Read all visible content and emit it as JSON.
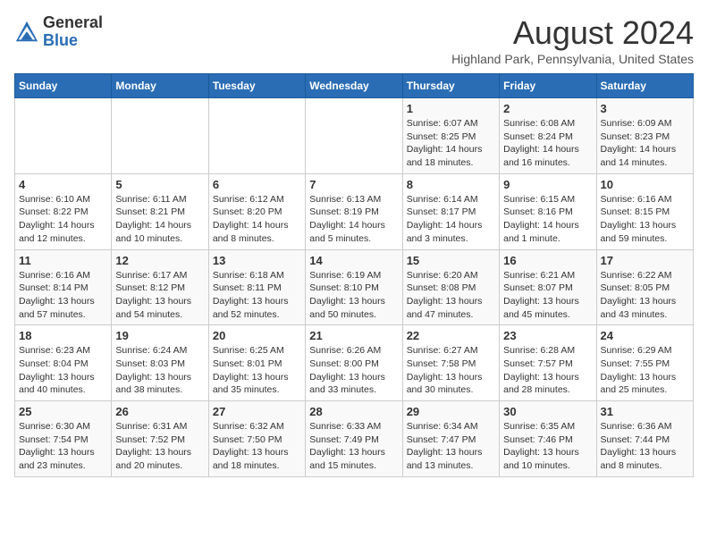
{
  "header": {
    "logo_general": "General",
    "logo_blue": "Blue",
    "month_year": "August 2024",
    "location": "Highland Park, Pennsylvania, United States"
  },
  "weekdays": [
    "Sunday",
    "Monday",
    "Tuesday",
    "Wednesday",
    "Thursday",
    "Friday",
    "Saturday"
  ],
  "weeks": [
    [
      {
        "day": "",
        "info": ""
      },
      {
        "day": "",
        "info": ""
      },
      {
        "day": "",
        "info": ""
      },
      {
        "day": "",
        "info": ""
      },
      {
        "day": "1",
        "info": "Sunrise: 6:07 AM\nSunset: 8:25 PM\nDaylight: 14 hours\nand 18 minutes."
      },
      {
        "day": "2",
        "info": "Sunrise: 6:08 AM\nSunset: 8:24 PM\nDaylight: 14 hours\nand 16 minutes."
      },
      {
        "day": "3",
        "info": "Sunrise: 6:09 AM\nSunset: 8:23 PM\nDaylight: 14 hours\nand 14 minutes."
      }
    ],
    [
      {
        "day": "4",
        "info": "Sunrise: 6:10 AM\nSunset: 8:22 PM\nDaylight: 14 hours\nand 12 minutes."
      },
      {
        "day": "5",
        "info": "Sunrise: 6:11 AM\nSunset: 8:21 PM\nDaylight: 14 hours\nand 10 minutes."
      },
      {
        "day": "6",
        "info": "Sunrise: 6:12 AM\nSunset: 8:20 PM\nDaylight: 14 hours\nand 8 minutes."
      },
      {
        "day": "7",
        "info": "Sunrise: 6:13 AM\nSunset: 8:19 PM\nDaylight: 14 hours\nand 5 minutes."
      },
      {
        "day": "8",
        "info": "Sunrise: 6:14 AM\nSunset: 8:17 PM\nDaylight: 14 hours\nand 3 minutes."
      },
      {
        "day": "9",
        "info": "Sunrise: 6:15 AM\nSunset: 8:16 PM\nDaylight: 14 hours\nand 1 minute."
      },
      {
        "day": "10",
        "info": "Sunrise: 6:16 AM\nSunset: 8:15 PM\nDaylight: 13 hours\nand 59 minutes."
      }
    ],
    [
      {
        "day": "11",
        "info": "Sunrise: 6:16 AM\nSunset: 8:14 PM\nDaylight: 13 hours\nand 57 minutes."
      },
      {
        "day": "12",
        "info": "Sunrise: 6:17 AM\nSunset: 8:12 PM\nDaylight: 13 hours\nand 54 minutes."
      },
      {
        "day": "13",
        "info": "Sunrise: 6:18 AM\nSunset: 8:11 PM\nDaylight: 13 hours\nand 52 minutes."
      },
      {
        "day": "14",
        "info": "Sunrise: 6:19 AM\nSunset: 8:10 PM\nDaylight: 13 hours\nand 50 minutes."
      },
      {
        "day": "15",
        "info": "Sunrise: 6:20 AM\nSunset: 8:08 PM\nDaylight: 13 hours\nand 47 minutes."
      },
      {
        "day": "16",
        "info": "Sunrise: 6:21 AM\nSunset: 8:07 PM\nDaylight: 13 hours\nand 45 minutes."
      },
      {
        "day": "17",
        "info": "Sunrise: 6:22 AM\nSunset: 8:05 PM\nDaylight: 13 hours\nand 43 minutes."
      }
    ],
    [
      {
        "day": "18",
        "info": "Sunrise: 6:23 AM\nSunset: 8:04 PM\nDaylight: 13 hours\nand 40 minutes."
      },
      {
        "day": "19",
        "info": "Sunrise: 6:24 AM\nSunset: 8:03 PM\nDaylight: 13 hours\nand 38 minutes."
      },
      {
        "day": "20",
        "info": "Sunrise: 6:25 AM\nSunset: 8:01 PM\nDaylight: 13 hours\nand 35 minutes."
      },
      {
        "day": "21",
        "info": "Sunrise: 6:26 AM\nSunset: 8:00 PM\nDaylight: 13 hours\nand 33 minutes."
      },
      {
        "day": "22",
        "info": "Sunrise: 6:27 AM\nSunset: 7:58 PM\nDaylight: 13 hours\nand 30 minutes."
      },
      {
        "day": "23",
        "info": "Sunrise: 6:28 AM\nSunset: 7:57 PM\nDaylight: 13 hours\nand 28 minutes."
      },
      {
        "day": "24",
        "info": "Sunrise: 6:29 AM\nSunset: 7:55 PM\nDaylight: 13 hours\nand 25 minutes."
      }
    ],
    [
      {
        "day": "25",
        "info": "Sunrise: 6:30 AM\nSunset: 7:54 PM\nDaylight: 13 hours\nand 23 minutes."
      },
      {
        "day": "26",
        "info": "Sunrise: 6:31 AM\nSunset: 7:52 PM\nDaylight: 13 hours\nand 20 minutes."
      },
      {
        "day": "27",
        "info": "Sunrise: 6:32 AM\nSunset: 7:50 PM\nDaylight: 13 hours\nand 18 minutes."
      },
      {
        "day": "28",
        "info": "Sunrise: 6:33 AM\nSunset: 7:49 PM\nDaylight: 13 hours\nand 15 minutes."
      },
      {
        "day": "29",
        "info": "Sunrise: 6:34 AM\nSunset: 7:47 PM\nDaylight: 13 hours\nand 13 minutes."
      },
      {
        "day": "30",
        "info": "Sunrise: 6:35 AM\nSunset: 7:46 PM\nDaylight: 13 hours\nand 10 minutes."
      },
      {
        "day": "31",
        "info": "Sunrise: 6:36 AM\nSunset: 7:44 PM\nDaylight: 13 hours\nand 8 minutes."
      }
    ]
  ]
}
